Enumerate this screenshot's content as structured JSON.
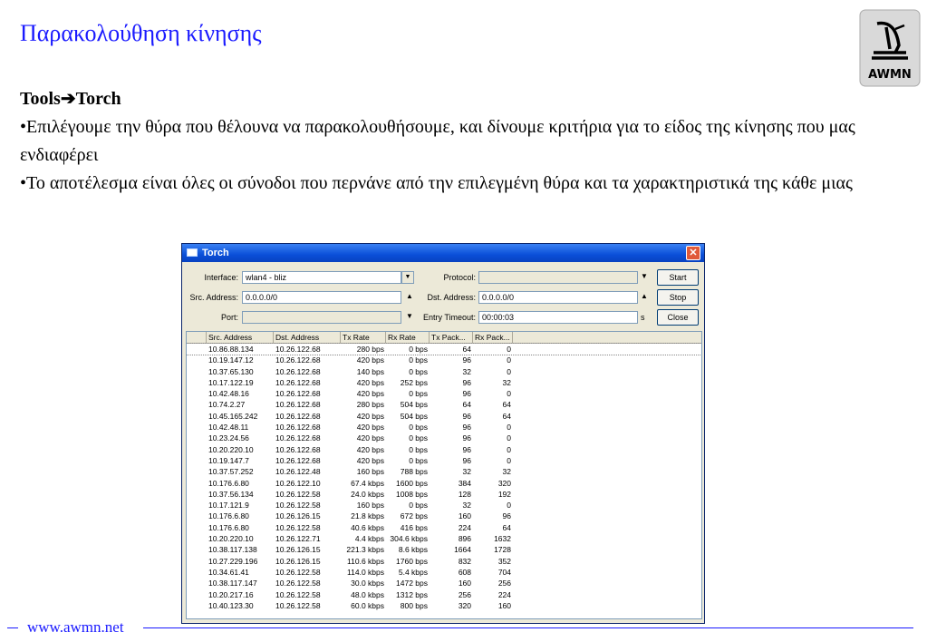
{
  "slide": {
    "title": "Παρακολούθηση κίνησης",
    "heading_tools": "Tools",
    "heading_arrow": "➔",
    "heading_torch": "Torch",
    "bullet1": "•Επιλέγουμε την θύρα που θέλουνα να παρακολουθήσουμε, και δίνουμε κριτήρια για το είδος της κίνησης που μας ενδιαφέρει",
    "bullet2": "•Το αποτέλεσμα είναι όλες οι σύνοδοι που περνάνε από την επιλεγμένη θύρα και τα χαρακτηριστικά της κάθε μιας",
    "logo_text": "AWMN",
    "footer": "www.awmn.net"
  },
  "window": {
    "title": "Torch",
    "close": "✕",
    "interface_label": "Interface:",
    "interface_value": "wlan4 - bliz",
    "protocol_label": "Protocol:",
    "protocol_value": "",
    "src_label": "Src. Address:",
    "src_value": "0.0.0.0/0",
    "dst_label": "Dst. Address:",
    "dst_value": "0.0.0.0/0",
    "port_label": "Port:",
    "port_value": "",
    "timeout_label": "Entry Timeout:",
    "timeout_value": "00:00:03",
    "timeout_unit": "s",
    "start": "Start",
    "stop": "Stop",
    "close_btn": "Close"
  },
  "table": {
    "columns": [
      "Src. Address",
      "Dst. Address",
      "Tx Rate",
      "Rx Rate",
      "Tx Pack...",
      "Rx Pack..."
    ],
    "rows": [
      [
        "10.86.88.134",
        "10.26.122.68",
        "280 bps",
        "0 bps",
        "64",
        "0"
      ],
      [
        "10.19.147.12",
        "10.26.122.68",
        "420 bps",
        "0 bps",
        "96",
        "0"
      ],
      [
        "10.37.65.130",
        "10.26.122.68",
        "140 bps",
        "0 bps",
        "32",
        "0"
      ],
      [
        "10.17.122.19",
        "10.26.122.68",
        "420 bps",
        "252 bps",
        "96",
        "32"
      ],
      [
        "10.42.48.16",
        "10.26.122.68",
        "420 bps",
        "0 bps",
        "96",
        "0"
      ],
      [
        "10.74.2.27",
        "10.26.122.68",
        "280 bps",
        "504 bps",
        "64",
        "64"
      ],
      [
        "10.45.165.242",
        "10.26.122.68",
        "420 bps",
        "504 bps",
        "96",
        "64"
      ],
      [
        "10.42.48.11",
        "10.26.122.68",
        "420 bps",
        "0 bps",
        "96",
        "0"
      ],
      [
        "10.23.24.56",
        "10.26.122.68",
        "420 bps",
        "0 bps",
        "96",
        "0"
      ],
      [
        "10.20.220.10",
        "10.26.122.68",
        "420 bps",
        "0 bps",
        "96",
        "0"
      ],
      [
        "10.19.147.7",
        "10.26.122.68",
        "420 bps",
        "0 bps",
        "96",
        "0"
      ],
      [
        "10.37.57.252",
        "10.26.122.48",
        "160 bps",
        "788 bps",
        "32",
        "32"
      ],
      [
        "10.176.6.80",
        "10.26.122.10",
        "67.4 kbps",
        "1600 bps",
        "384",
        "320"
      ],
      [
        "10.37.56.134",
        "10.26.122.58",
        "24.0 kbps",
        "1008 bps",
        "128",
        "192"
      ],
      [
        "10.17.121.9",
        "10.26.122.58",
        "160 bps",
        "0 bps",
        "32",
        "0"
      ],
      [
        "10.176.6.80",
        "10.26.126.15",
        "21.8 kbps",
        "672 bps",
        "160",
        "96"
      ],
      [
        "10.176.6.80",
        "10.26.122.58",
        "40.6 kbps",
        "416 bps",
        "224",
        "64"
      ],
      [
        "10.20.220.10",
        "10.26.122.71",
        "4.4 kbps",
        "304.6 kbps",
        "896",
        "1632"
      ],
      [
        "10.38.117.138",
        "10.26.126.15",
        "221.3 kbps",
        "8.6 kbps",
        "1664",
        "1728"
      ],
      [
        "10.27.229.196",
        "10.26.126.15",
        "110.6 kbps",
        "1760 bps",
        "832",
        "352"
      ],
      [
        "10.34.61.41",
        "10.26.122.58",
        "114.0 kbps",
        "5.4 kbps",
        "608",
        "704"
      ],
      [
        "10.38.117.147",
        "10.26.122.58",
        "30.0 kbps",
        "1472 bps",
        "160",
        "256"
      ],
      [
        "10.20.217.16",
        "10.26.122.58",
        "48.0 kbps",
        "1312 bps",
        "256",
        "224"
      ],
      [
        "10.40.123.30",
        "10.26.122.58",
        "60.0 kbps",
        "800 bps",
        "320",
        "160"
      ]
    ]
  }
}
